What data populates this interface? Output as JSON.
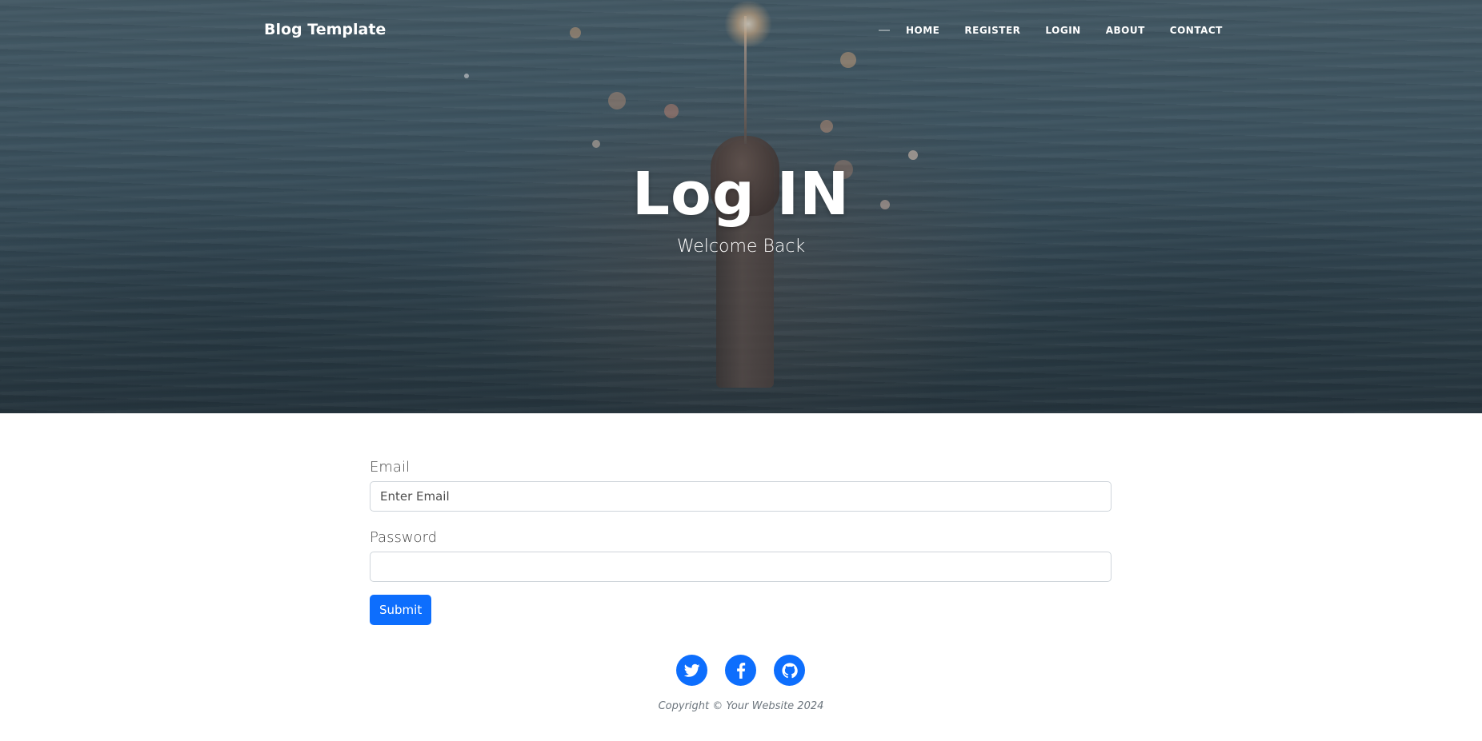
{
  "navbar": {
    "brand": "Blog Template",
    "links": [
      "HOME",
      "REGISTER",
      "LOGIN",
      "ABOUT",
      "CONTACT"
    ]
  },
  "hero": {
    "title": "Log IN",
    "subtitle": "Welcome Back"
  },
  "form": {
    "email_label": "Email",
    "email_placeholder": "Enter Email",
    "email_value": "",
    "password_label": "Password",
    "password_value": "",
    "submit_label": "Submit"
  },
  "footer": {
    "social_icons": [
      "twitter-icon",
      "facebook-icon",
      "github-icon"
    ],
    "copyright": "Copyright © Your Website 2024"
  },
  "colors": {
    "accent": "#0d6efd",
    "hero_text": "#ffffff",
    "muted": "#6c757d"
  }
}
